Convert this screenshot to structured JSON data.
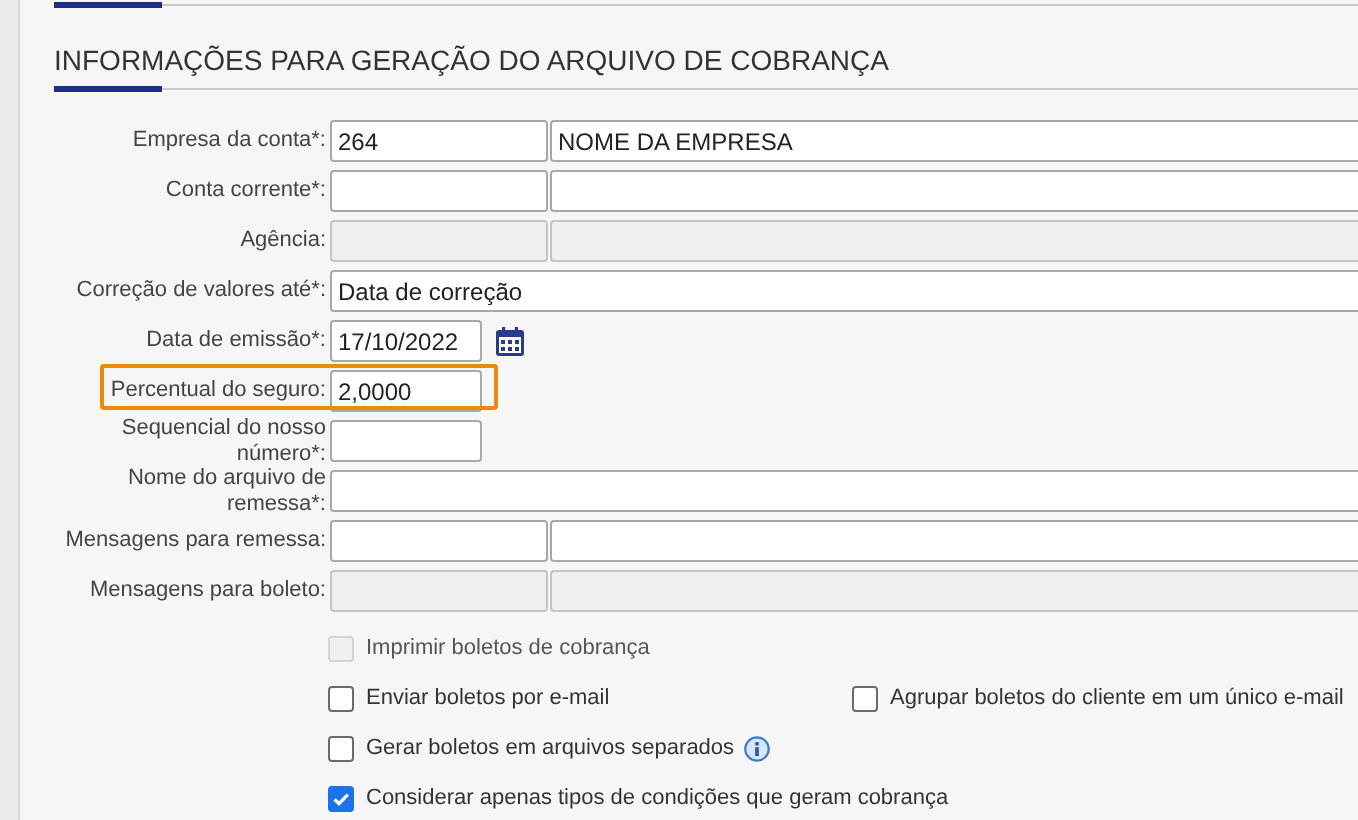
{
  "section": {
    "title": "INFORMAÇÕES PARA GERAÇÃO DO ARQUIVO DE COBRANÇA"
  },
  "form_rows": [
    {
      "label": "Empresa da conta*:",
      "kind": "pair",
      "values": [
        "264",
        "NOME DA EMPRESA"
      ],
      "disabled": false,
      "highlighted": false
    },
    {
      "label": "Conta corrente*:",
      "kind": "pair",
      "values": [],
      "disabled": false,
      "highlighted": false
    },
    {
      "label": "Agência:",
      "kind": "pair",
      "values": [],
      "disabled": true,
      "highlighted": false
    },
    {
      "label": "Correção de valores até*:",
      "kind": "single",
      "values": [
        "Data de correção"
      ],
      "disabled": false,
      "highlighted": false
    },
    {
      "label": "Data de emissão*:",
      "kind": "date",
      "values": [
        "17/10/2022"
      ],
      "disabled": false,
      "highlighted": false
    },
    {
      "label": "Percentual do seguro:",
      "kind": "small",
      "values": [
        "2,0000"
      ],
      "disabled": false,
      "highlighted": true
    },
    {
      "label": "Sequencial do nosso número*:",
      "kind": "small",
      "values": [],
      "disabled": false,
      "highlighted": false
    },
    {
      "label": "Nome do arquivo de remessa*:",
      "kind": "single",
      "values": [],
      "disabled": false,
      "highlighted": false
    },
    {
      "label": "Mensagens para remessa:",
      "kind": "pair",
      "values": [],
      "disabled": false,
      "highlighted": false
    },
    {
      "label": "Mensagens para boleto:",
      "kind": "pair",
      "values": [],
      "disabled": true,
      "highlighted": false
    }
  ],
  "option_rows": [
    [
      {
        "label": "Imprimir boletos de cobrança",
        "checked": false,
        "disabled": true,
        "info": false
      }
    ],
    [
      {
        "label": "Enviar boletos por e-mail",
        "checked": false,
        "disabled": false,
        "info": false
      },
      {
        "label": "Agrupar boletos do cliente em um único e-mail",
        "checked": false,
        "disabled": false,
        "info": false
      }
    ],
    [
      {
        "label": "Gerar boletos em arquivos separados",
        "checked": false,
        "disabled": false,
        "info": true
      }
    ],
    [
      {
        "label": "Considerar apenas tipos de condições que geram cobrança",
        "checked": true,
        "disabled": false,
        "info": false
      }
    ]
  ]
}
